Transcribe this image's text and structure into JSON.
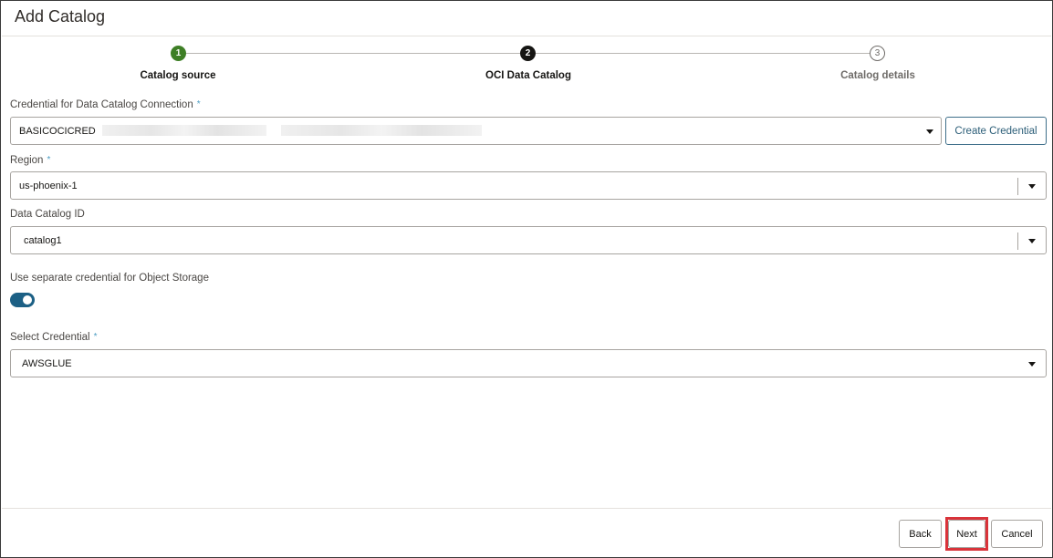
{
  "dialog": {
    "title": "Add Catalog"
  },
  "stepper": {
    "steps": [
      {
        "number": "1",
        "label": "Catalog source",
        "state": "complete"
      },
      {
        "number": "2",
        "label": "OCI Data Catalog",
        "state": "current"
      },
      {
        "number": "3",
        "label": "Catalog details",
        "state": "upcoming"
      }
    ]
  },
  "fields": {
    "credential": {
      "label": "Credential for Data Catalog Connection",
      "required_mark": "*",
      "value": "BASICOCICRED"
    },
    "region": {
      "label": "Region",
      "required_mark": "*",
      "value": "us-phoenix-1"
    },
    "catalog_id": {
      "label": "Data Catalog ID",
      "value": "catalog1"
    },
    "separate_credential": {
      "label": "Use separate credential for Object Storage",
      "enabled": true
    },
    "select_credential": {
      "label": "Select Credential",
      "required_mark": "*",
      "value": "AWSGLUE"
    }
  },
  "buttons": {
    "create_credential": "Create Credential",
    "back": "Back",
    "next": "Next",
    "cancel": "Cancel"
  },
  "colors": {
    "step_complete": "#3e7f26",
    "step_current": "#161513",
    "toggle_on": "#1c6085",
    "highlight": "#d9333a"
  },
  "icons": [
    "chevron-down-icon",
    "check-step-icon"
  ]
}
